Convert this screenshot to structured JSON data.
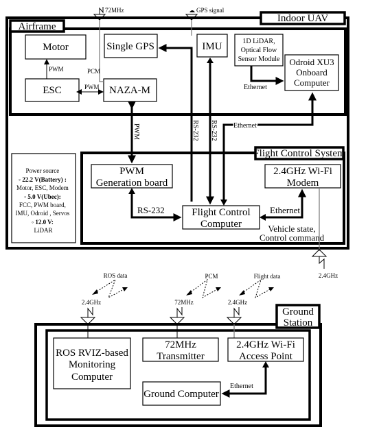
{
  "uav": {
    "title": "Indoor UAV",
    "airframe": {
      "title": "Airframe",
      "motor": "Motor",
      "esc": "ESC",
      "single_gps": "Single GPS",
      "naza": "NAZA-M",
      "imu": "IMU",
      "lidar": [
        "1D LiDAR,",
        "Optical Flow",
        "Sensor Module"
      ],
      "odroid": [
        "Odroid XU3",
        "Onboard",
        "Computer"
      ]
    },
    "links": {
      "pwm_motor": "PWM",
      "pwm_esc": "PWM",
      "pcm": "PCM",
      "ant_72": "72MHz",
      "ant_gps": "GPS signal",
      "eth_lidar": "Ethernet",
      "eth_odroid": "Ethernet",
      "pwm_vertical": "PWM",
      "rs232_gps": "RS-232",
      "rs232_imu": "RS-232",
      "rs232_pwm": "RS-232",
      "eth_modem": "Ethernet",
      "vehicle_state": [
        "Vehicle state,",
        "Control command"
      ],
      "ant_modem": "2.4GHz"
    },
    "power": {
      "lines": [
        {
          "text": "Power source",
          "bold": false
        },
        {
          "text": "◦ 22.2 V(Battery) :",
          "bold": true
        },
        {
          "text": "Motor, ESC, Modem",
          "bold": false
        },
        {
          "text": "◦ 5.0 V(Ubec):",
          "bold": true
        },
        {
          "text": "FCC, PWM board,",
          "bold": false
        },
        {
          "text": "IMU, Odroid , Servos",
          "bold": false
        },
        {
          "text": "◦ 12.0 V:",
          "bold": true
        },
        {
          "text": "LiDAR",
          "bold": false
        }
      ]
    },
    "fcs": {
      "title": "Flight Control System",
      "pwm_board": [
        "PWM",
        "Generation board"
      ],
      "modem": [
        "2.4GHz Wi-Fi",
        "Modem"
      ],
      "fcc": [
        "Flight Control",
        "Computer"
      ]
    }
  },
  "wireless": {
    "ros_data": "ROS data",
    "pcm": "PCM",
    "flight_data": "Flight data",
    "ant_ros": "2.4GHz",
    "ant_tx": "72MHz",
    "ant_ap": "2.4GHz"
  },
  "ground": {
    "title": [
      "Ground",
      "Station"
    ],
    "ros_rviz": [
      "ROS RVIZ-based",
      "Monitoring",
      "Computer"
    ],
    "transmitter": [
      "72MHz",
      "Transmitter"
    ],
    "access_point": [
      "2.4GHz Wi-Fi",
      "Access Point"
    ],
    "ground_computer": "Ground Computer",
    "ethernet": "Ethernet"
  }
}
